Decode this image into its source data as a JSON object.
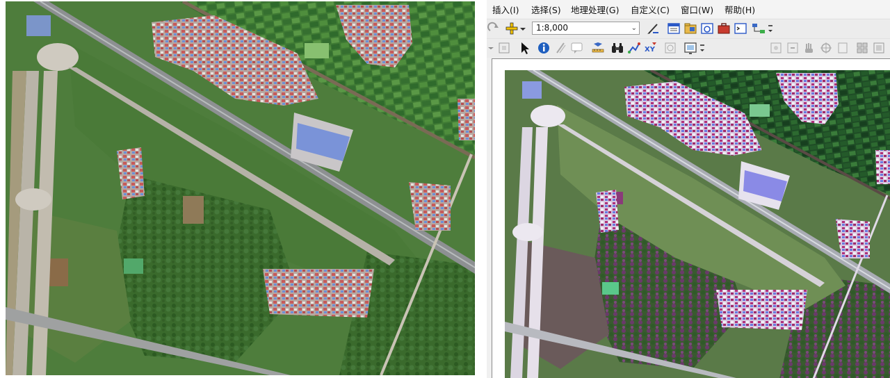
{
  "menu": {
    "items": [
      {
        "label": "插入(I)"
      },
      {
        "label": "选择(S)"
      },
      {
        "label": "地理处理(G)"
      },
      {
        "label": "自定义(C)"
      },
      {
        "label": "窗口(W)"
      },
      {
        "label": "帮助(H)"
      }
    ]
  },
  "toolbar": {
    "scale_value": "1:8,000",
    "xy_label": "XY"
  },
  "icons": {
    "add_data": "add-data-icon",
    "select": "select-arrow-icon",
    "identify": "identify-icon",
    "find": "binoculars-icon",
    "goto_xy": "goto-xy-icon"
  },
  "colors": {
    "identify_blue": "#1f5fbf",
    "add_data_yellow": "#f2c200",
    "imagery_green": "#4b7a3a",
    "road_gray": "#8d9092"
  }
}
